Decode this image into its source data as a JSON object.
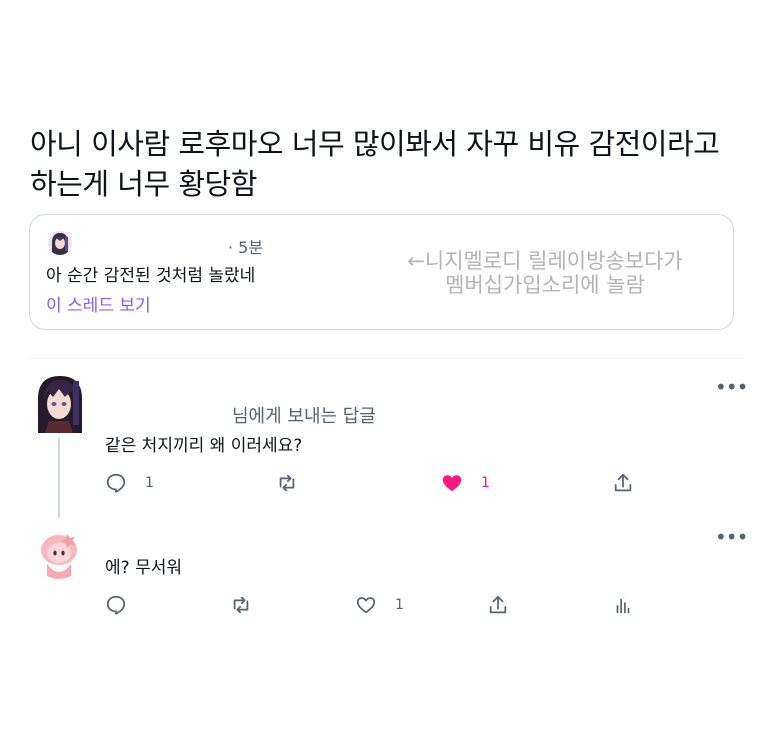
{
  "tweet": {
    "text": "아니 이사람 로후마오 너무 많이봐서 자꾸 비유 감전이라고 하는게 너무 황당함"
  },
  "quote": {
    "time": "· 5분",
    "text": "아 순간 감전된 것처럼 놀랐네",
    "thread_link": "이 스레드 보기",
    "annotation_line1": "←니지멜로디 릴레이방송보다가",
    "annotation_line2": "멤버십가입소리에 놀람"
  },
  "reply1": {
    "more_icon": "more-icon",
    "reply_to": "님에게 보내는 답글",
    "text": "같은 처지끼리 왜 이러세요?",
    "reply_count": "1",
    "like_count": "1",
    "liked": true,
    "like_color": "#f91880"
  },
  "reply2": {
    "more_icon": "more-icon",
    "text": "에? 무서워",
    "like_count": "1"
  },
  "colors": {
    "link": "#8c5af5",
    "muted": "#536471",
    "annotation": "#b4b4b4",
    "border": "#cfd9de"
  }
}
